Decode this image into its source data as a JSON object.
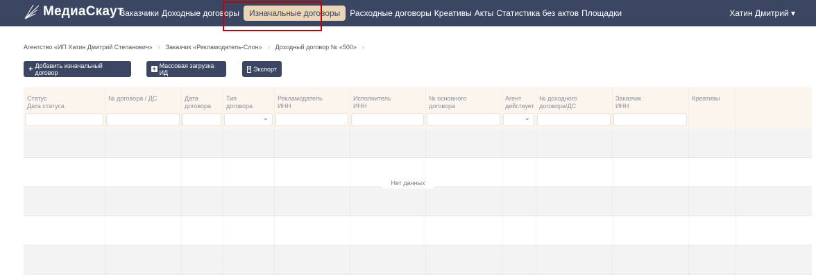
{
  "nav": {
    "brand": "МедиаСкаут",
    "items": [
      "Заказчики",
      "Доходные договоры",
      "Изначальные договоры",
      "Расходные договоры",
      "Креативы",
      "Акты",
      "Статистика без актов",
      "Площадки"
    ],
    "active_index": 2,
    "user": "Хатин Дмитрий"
  },
  "breadcrumb": [
    "Агентство «ИП Хатин Дмитрий Степанович»",
    "Заказчик «Рекламодатель-Слон»",
    "Доходный договор № «500»"
  ],
  "toolbar": {
    "add": "Добавить изначальный договор",
    "bulk": "Массовая загрузка ИД",
    "export": "Экспорт"
  },
  "table": {
    "columns": [
      {
        "l1": "Статус",
        "l2": "Дата статуса",
        "filter": "text"
      },
      {
        "l1": "№ договора / ДС",
        "l2": "",
        "filter": "text"
      },
      {
        "l1": "Дата",
        "l2": "договора",
        "filter": "text"
      },
      {
        "l1": "Тип",
        "l2": "договора",
        "filter": "select"
      },
      {
        "l1": "Рекламодатель",
        "l2": "ИНН",
        "filter": "text"
      },
      {
        "l1": "Исполнитель",
        "l2": "ИНН",
        "filter": "text"
      },
      {
        "l1": "№ основного",
        "l2": "договора",
        "filter": "text"
      },
      {
        "l1": "Агент",
        "l2": "действует",
        "filter": "select"
      },
      {
        "l1": "№ доходного",
        "l2": "договора/ДС",
        "filter": "text"
      },
      {
        "l1": "Заказчик",
        "l2": "ИНН",
        "filter": "text"
      },
      {
        "l1": "Креативы",
        "l2": "",
        "filter": "none"
      },
      {
        "l1": "",
        "l2": "",
        "filter": "none"
      }
    ],
    "empty": "Нет данных"
  }
}
